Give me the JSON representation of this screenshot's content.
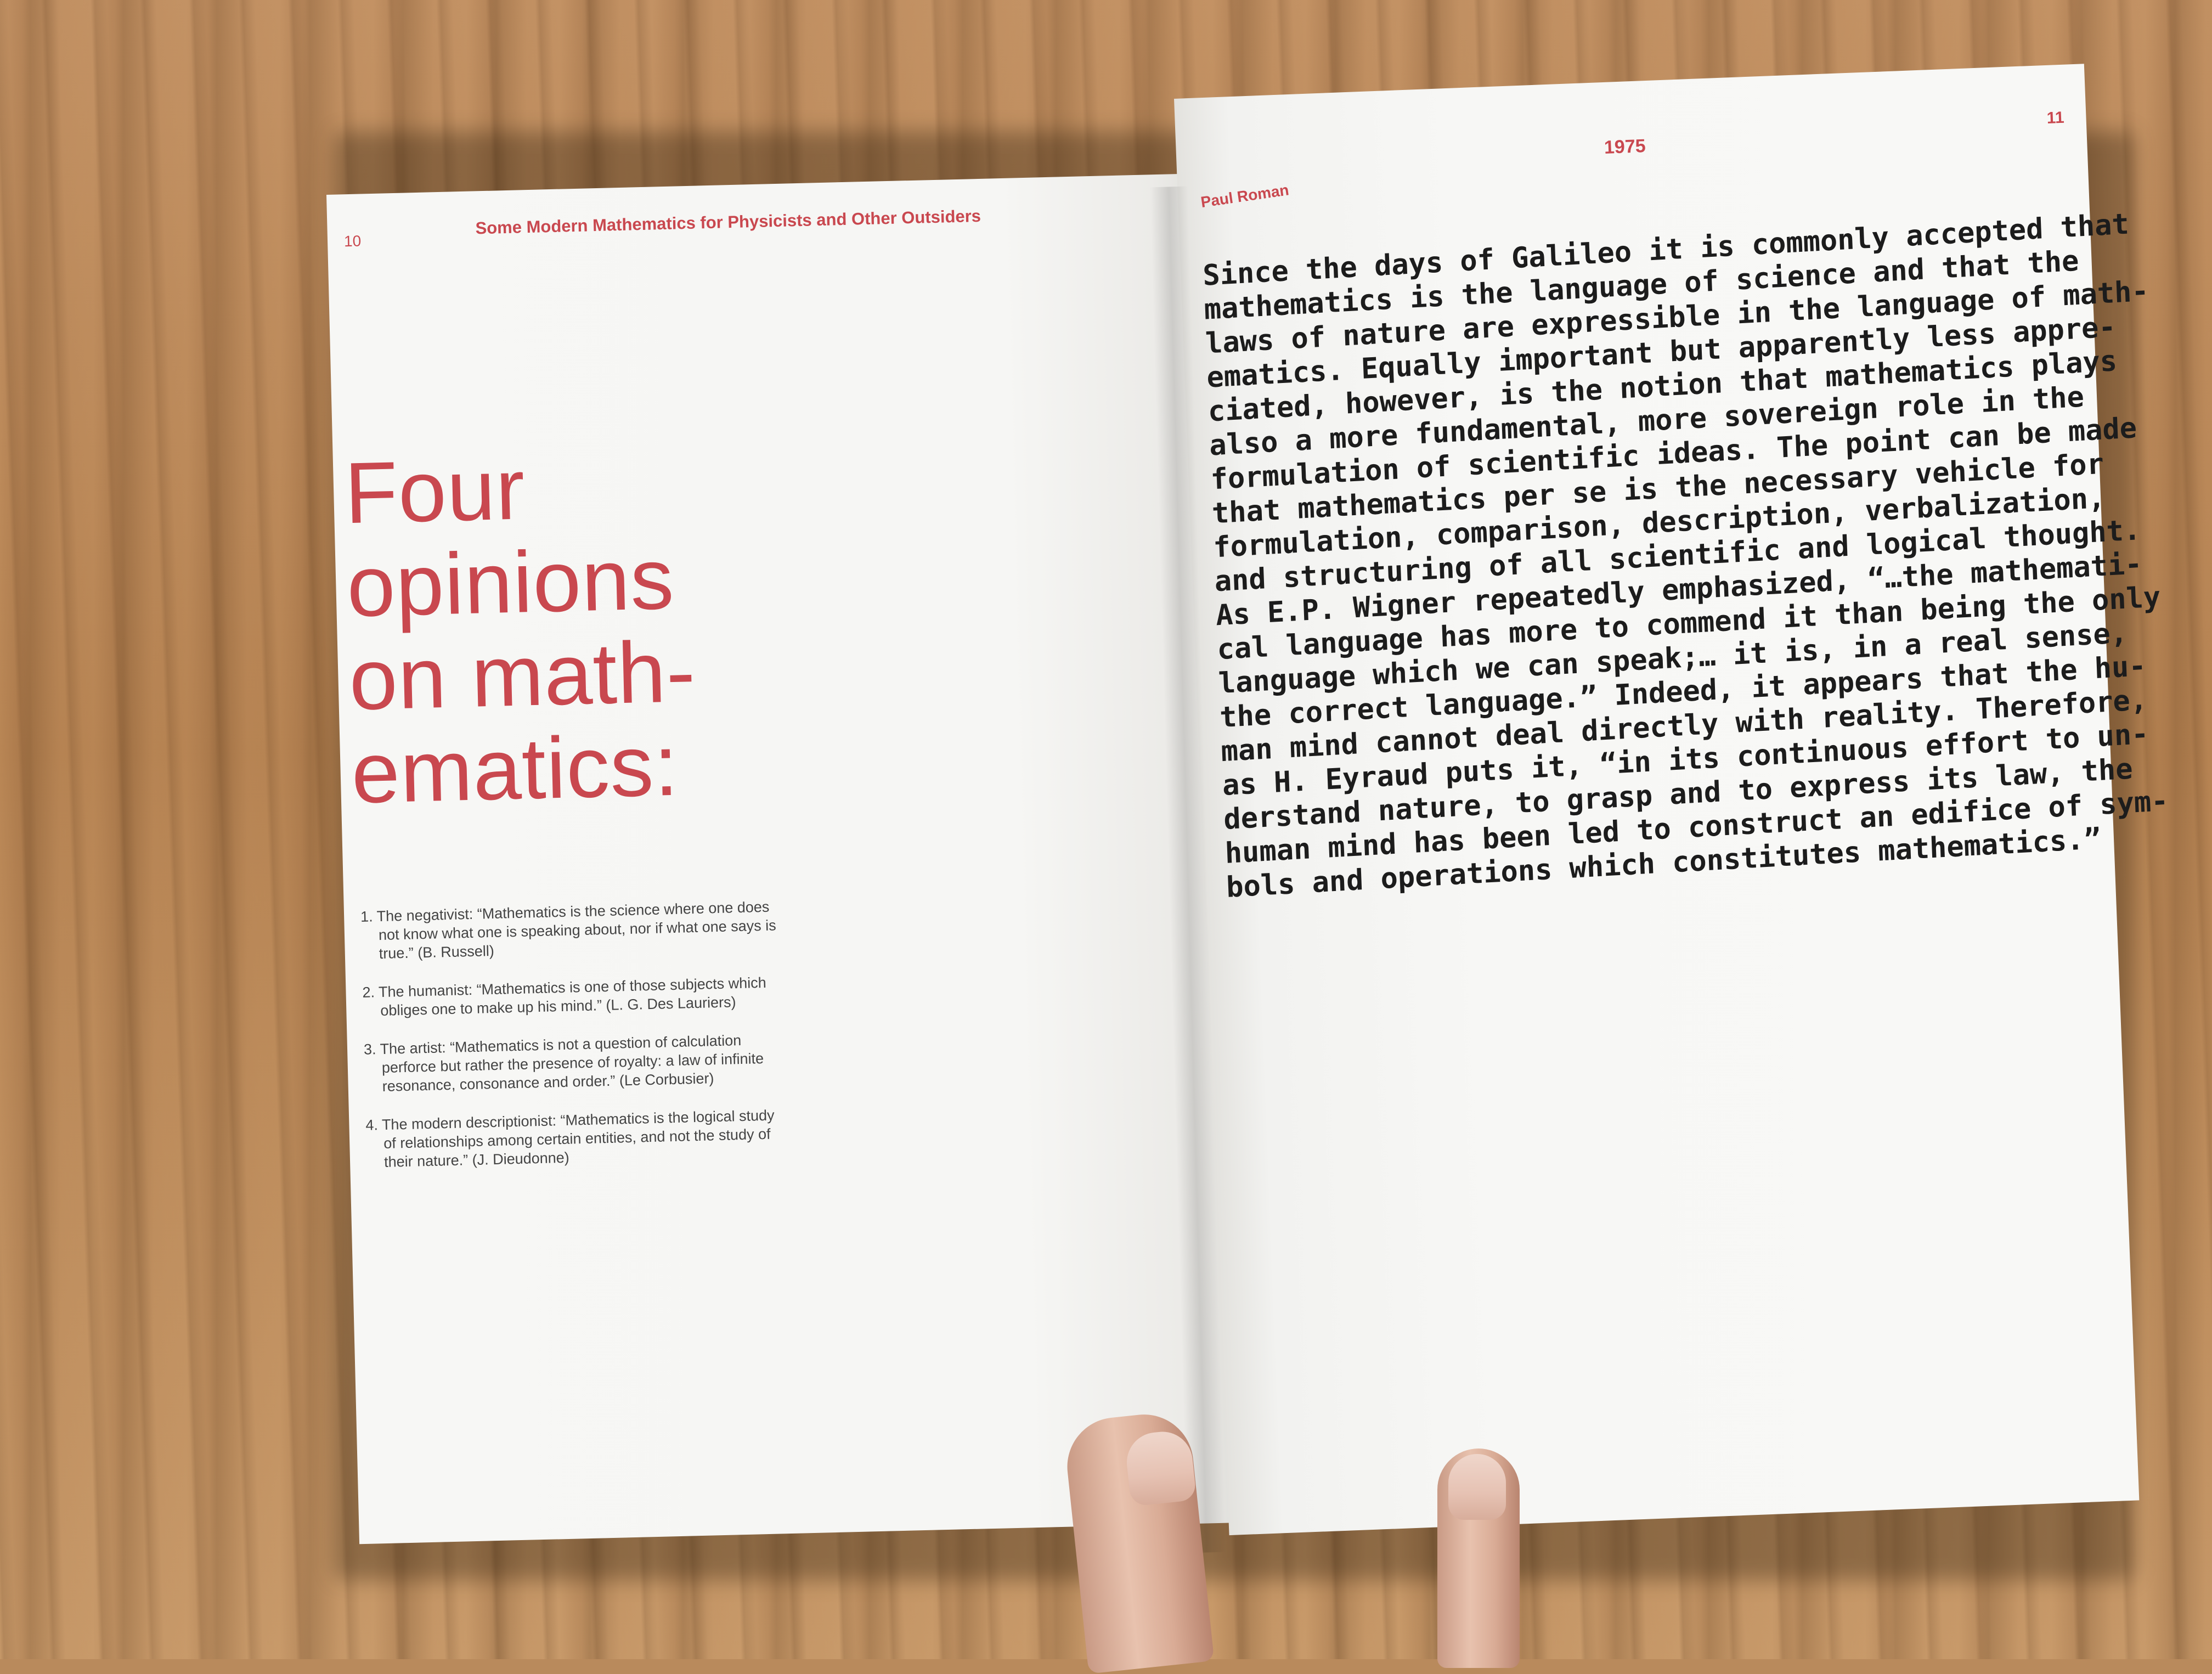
{
  "left_page": {
    "page_number": "10",
    "running_title": "Some Modern Mathematics for Physicists and Other Outsiders",
    "headline_lines": [
      "Four",
      "opinions",
      "on math-",
      "ematics:"
    ],
    "opinions": [
      "1. The negativist: “Mathematics is the science where one does not know what one is speaking about, nor if what one says is true.” (B. Russell)",
      "2. The humanist: “Mathematics is one of those subjects which obliges one to make up his mind.” (L. G. Des Lauriers)",
      "3. The artist: “Mathematics is not a question of calculation perforce but rather the presence of royalty: a law of infinite resonance, consonance and order.” (Le Corbusier)",
      "4. The modern descriptionist: “Mathematics is the logical study of relationships among certain entities, and not the study of their nature.” (J. Dieudonne)"
    ]
  },
  "right_page": {
    "page_number": "11",
    "year": "1975",
    "author": "Paul Roman",
    "body_lines": [
      "Since the days of Galileo it is commonly accepted that",
      "mathematics is the language of science and that the",
      "laws of nature are expressible in the language of math-",
      "ematics. Equally important but apparently less appre-",
      "ciated, however, is the notion that mathematics plays",
      "also a more fundamental, more sovereign role in the",
      "formulation of scientific ideas. The point can be made",
      "that mathematics per se is the necessary vehicle for",
      "formulation, comparison, description, verbalization,",
      "and structuring of all scientific and logical thought.",
      "As E.P. Wigner repeatedly emphasized, “…the mathemati-",
      "cal language has more to commend it than being the only",
      "language which we can speak;… it is, in a real sense,",
      "the correct language.” Indeed, it appears that the hu-",
      "man mind cannot deal directly with reality. Therefore,",
      "as H. Eyraud puts it, “in its continuous effort to un-",
      "derstand nature, to grasp and to express its law, the",
      "human mind has been led to construct an edifice of sym-",
      "bols and operations which constitutes mathematics.”"
    ]
  },
  "colors": {
    "accent_red": "#c9484f",
    "paper": "#f7f7f5",
    "wood": "#b98a5c"
  }
}
